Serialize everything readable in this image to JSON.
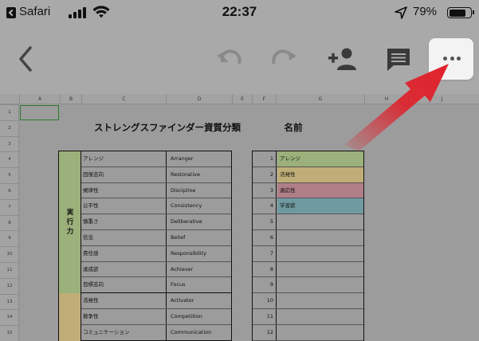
{
  "status_bar": {
    "back_app": "Safari",
    "time": "22:37",
    "battery_percent": "79%",
    "battery_level": 0.79
  },
  "toolbar": {
    "icons": [
      "back-icon",
      "undo-icon",
      "redo-icon",
      "add-person-icon",
      "comment-icon",
      "more-icon"
    ],
    "more_background": "#f3f3f3"
  },
  "sheet": {
    "columns": [
      "A",
      "B",
      "C",
      "D",
      "E",
      "F",
      "G",
      "H",
      "I",
      "J"
    ],
    "rows": [
      "1",
      "2",
      "3",
      "4",
      "5",
      "6",
      "7",
      "8",
      "9",
      "10",
      "11",
      "12",
      "13",
      "14",
      "15"
    ],
    "title_strengths": "ストレングスファインダー資質分類",
    "title_name": "名前",
    "groups": [
      {
        "label": "実行力",
        "color": "#9bb07a",
        "items": [
          {
            "jp": "アレンジ",
            "en": "Arranger"
          },
          {
            "jp": "回復志向",
            "en": "Restorative"
          },
          {
            "jp": "規律性",
            "en": "Discipline"
          },
          {
            "jp": "公平性",
            "en": "Consistency"
          },
          {
            "jp": "慎重さ",
            "en": "Deliberative"
          },
          {
            "jp": "信念",
            "en": "Belief"
          },
          {
            "jp": "責任感",
            "en": "Responsibility"
          },
          {
            "jp": "達成欲",
            "en": "Achiever"
          },
          {
            "jp": "目標志向",
            "en": "Focus"
          }
        ]
      },
      {
        "label": "",
        "color": "#bfae78",
        "items": [
          {
            "jp": "活発性",
            "en": "Activator"
          },
          {
            "jp": "競争性",
            "en": "Competition"
          },
          {
            "jp": "コミュニケーション",
            "en": "Communication"
          }
        ]
      }
    ],
    "ranking": [
      {
        "num": "1",
        "name": "アレンジ",
        "color": "#9bb07a"
      },
      {
        "num": "2",
        "name": "活発性",
        "color": "#bfae78"
      },
      {
        "num": "3",
        "name": "適応性",
        "color": "#b07e86"
      },
      {
        "num": "4",
        "name": "学習欲",
        "color": "#6f9aa0"
      },
      {
        "num": "5",
        "name": "",
        "color": ""
      },
      {
        "num": "6",
        "name": "",
        "color": ""
      },
      {
        "num": "7",
        "name": "",
        "color": ""
      },
      {
        "num": "8",
        "name": "",
        "color": ""
      },
      {
        "num": "9",
        "name": "",
        "color": ""
      },
      {
        "num": "10",
        "name": "",
        "color": ""
      },
      {
        "num": "11",
        "name": "",
        "color": ""
      },
      {
        "num": "12",
        "name": "",
        "color": ""
      }
    ]
  },
  "annotation": {
    "arrow_color": "#e0202a"
  }
}
